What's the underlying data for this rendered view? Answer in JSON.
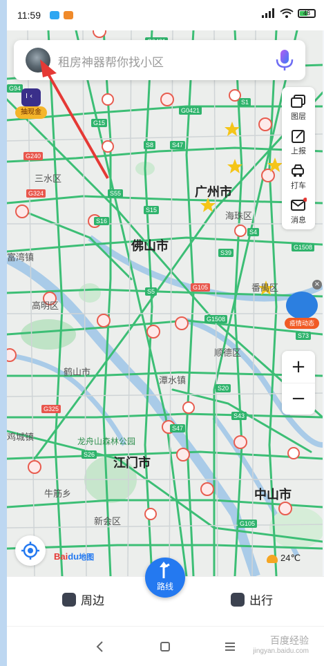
{
  "status_bar": {
    "time": "11:59",
    "battery": "48"
  },
  "search": {
    "placeholder": "租房神器帮你找小区"
  },
  "promo_badge": {
    "label": "抽现金"
  },
  "toolbar": {
    "layers": "图层",
    "report": "上报",
    "taxi": "打车",
    "messages": "消息"
  },
  "epidemic_badge": {
    "label": "疫情动态"
  },
  "zoom": {
    "in": "+",
    "out": "−"
  },
  "map": {
    "cities": [
      "广州市",
      "佛山市",
      "江门市",
      "中山市"
    ],
    "districts": [
      "三水区",
      "海珠区",
      "富湾镇",
      "高明区",
      "鹤山市",
      "顺德区",
      "潭水镇",
      "鸡城镇",
      "龙舟山森林公园",
      "牛筋乡",
      "新会区",
      "番禺区"
    ],
    "road_shields": [
      "G0421",
      "G15",
      "S8",
      "S47",
      "S1",
      "G0421",
      "G240",
      "G324",
      "S55",
      "S15",
      "S16",
      "S39",
      "G105",
      "G1508",
      "S5",
      "S4",
      "G1508",
      "S73",
      "G325",
      "S20",
      "S43",
      "S47",
      "S26",
      "G105",
      "G94"
    ]
  },
  "map_logo": {
    "text": "Bai",
    "text2": "地图"
  },
  "weather": {
    "temp": "24℃"
  },
  "bottom_tabs": {
    "nearby": "周边",
    "route": "路线",
    "travel": "出行"
  },
  "watermark": {
    "site": "jingyan.baidu.com",
    "brand": "百度经验"
  },
  "colors": {
    "accent": "#2479f0",
    "road": "#2fb36c",
    "arrow": "#e53935"
  }
}
